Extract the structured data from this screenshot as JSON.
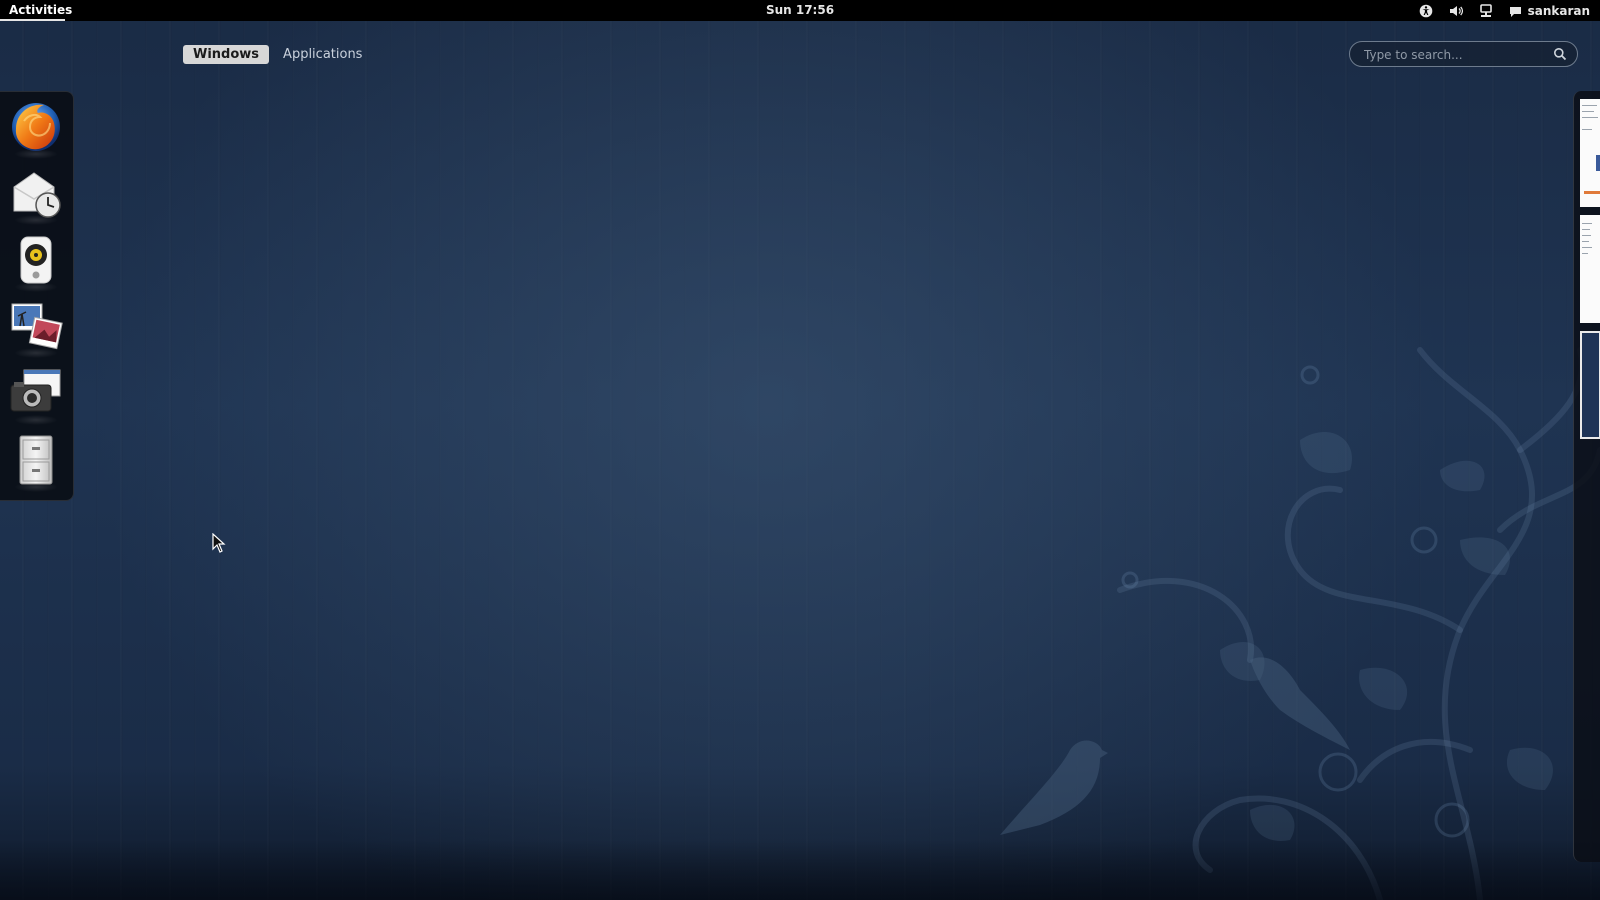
{
  "topbar": {
    "activities_label": "Activities",
    "clock": "Sun 17:56",
    "user_name": "sankaran",
    "tray_icons": [
      "accessibility-icon",
      "volume-icon",
      "network-icon",
      "chat-icon"
    ]
  },
  "overview": {
    "tabs": [
      {
        "label": "Windows",
        "active": true
      },
      {
        "label": "Applications",
        "active": false
      }
    ]
  },
  "search": {
    "placeholder": "Type to search..."
  },
  "dash": {
    "items": [
      {
        "name": "firefox",
        "icon": "firefox-icon"
      },
      {
        "name": "evolution",
        "icon": "mail-clock-icon"
      },
      {
        "name": "rhythmbox",
        "icon": "speaker-icon"
      },
      {
        "name": "shotwell",
        "icon": "photos-icon"
      },
      {
        "name": "screenshot",
        "icon": "camera-icon"
      },
      {
        "name": "files",
        "icon": "file-cabinet-icon"
      }
    ]
  },
  "workspaces": {
    "count": 3,
    "active_index": 2
  },
  "colors": {
    "topbar": "#000000",
    "wallpaper": "#1f3452",
    "tab_active": "#d7d7d7"
  }
}
